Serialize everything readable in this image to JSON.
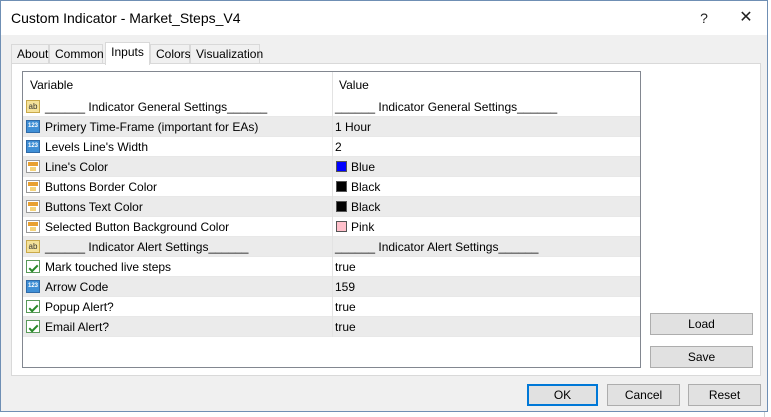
{
  "window": {
    "title": "Custom Indicator - Market_Steps_V4"
  },
  "titlebar": {
    "help": "?",
    "close": "✕"
  },
  "tabs": [
    "About",
    "Common",
    "Inputs",
    "Colors",
    "Visualization"
  ],
  "active_tab": "Inputs",
  "grid": {
    "columns": {
      "variable": "Variable",
      "value": "Value"
    },
    "rows": [
      {
        "type": "ab",
        "name": "______ Indicator General Settings______",
        "value": "______ Indicator General Settings______"
      },
      {
        "type": "123",
        "name": "Primery Time-Frame (important for EAs)",
        "value": "1 Hour"
      },
      {
        "type": "123",
        "name": "Levels Line's Width",
        "value": "2"
      },
      {
        "type": "color",
        "name": "Line's Color",
        "value": "Blue",
        "swatch": "#0000ff"
      },
      {
        "type": "color",
        "name": "Buttons Border Color",
        "value": "Black",
        "swatch": "#000000"
      },
      {
        "type": "color",
        "name": "Buttons Text Color",
        "value": "Black",
        "swatch": "#000000"
      },
      {
        "type": "color",
        "name": "Selected Button Background Color",
        "value": "Pink",
        "swatch": "#ffc0cb"
      },
      {
        "type": "ab",
        "name": "______ Indicator Alert Settings______",
        "value": "______ Indicator Alert Settings______"
      },
      {
        "type": "bool",
        "name": "Mark touched live steps",
        "value": "true"
      },
      {
        "type": "123",
        "name": "Arrow Code",
        "value": "159"
      },
      {
        "type": "bool",
        "name": "Popup Alert?",
        "value": "true"
      },
      {
        "type": "bool",
        "name": "Email Alert?",
        "value": "true"
      }
    ]
  },
  "buttons": {
    "load": "Load",
    "save": "Save",
    "ok": "OK",
    "cancel": "Cancel",
    "reset": "Reset"
  },
  "icons": {
    "ab": "ab",
    "123": "123"
  }
}
